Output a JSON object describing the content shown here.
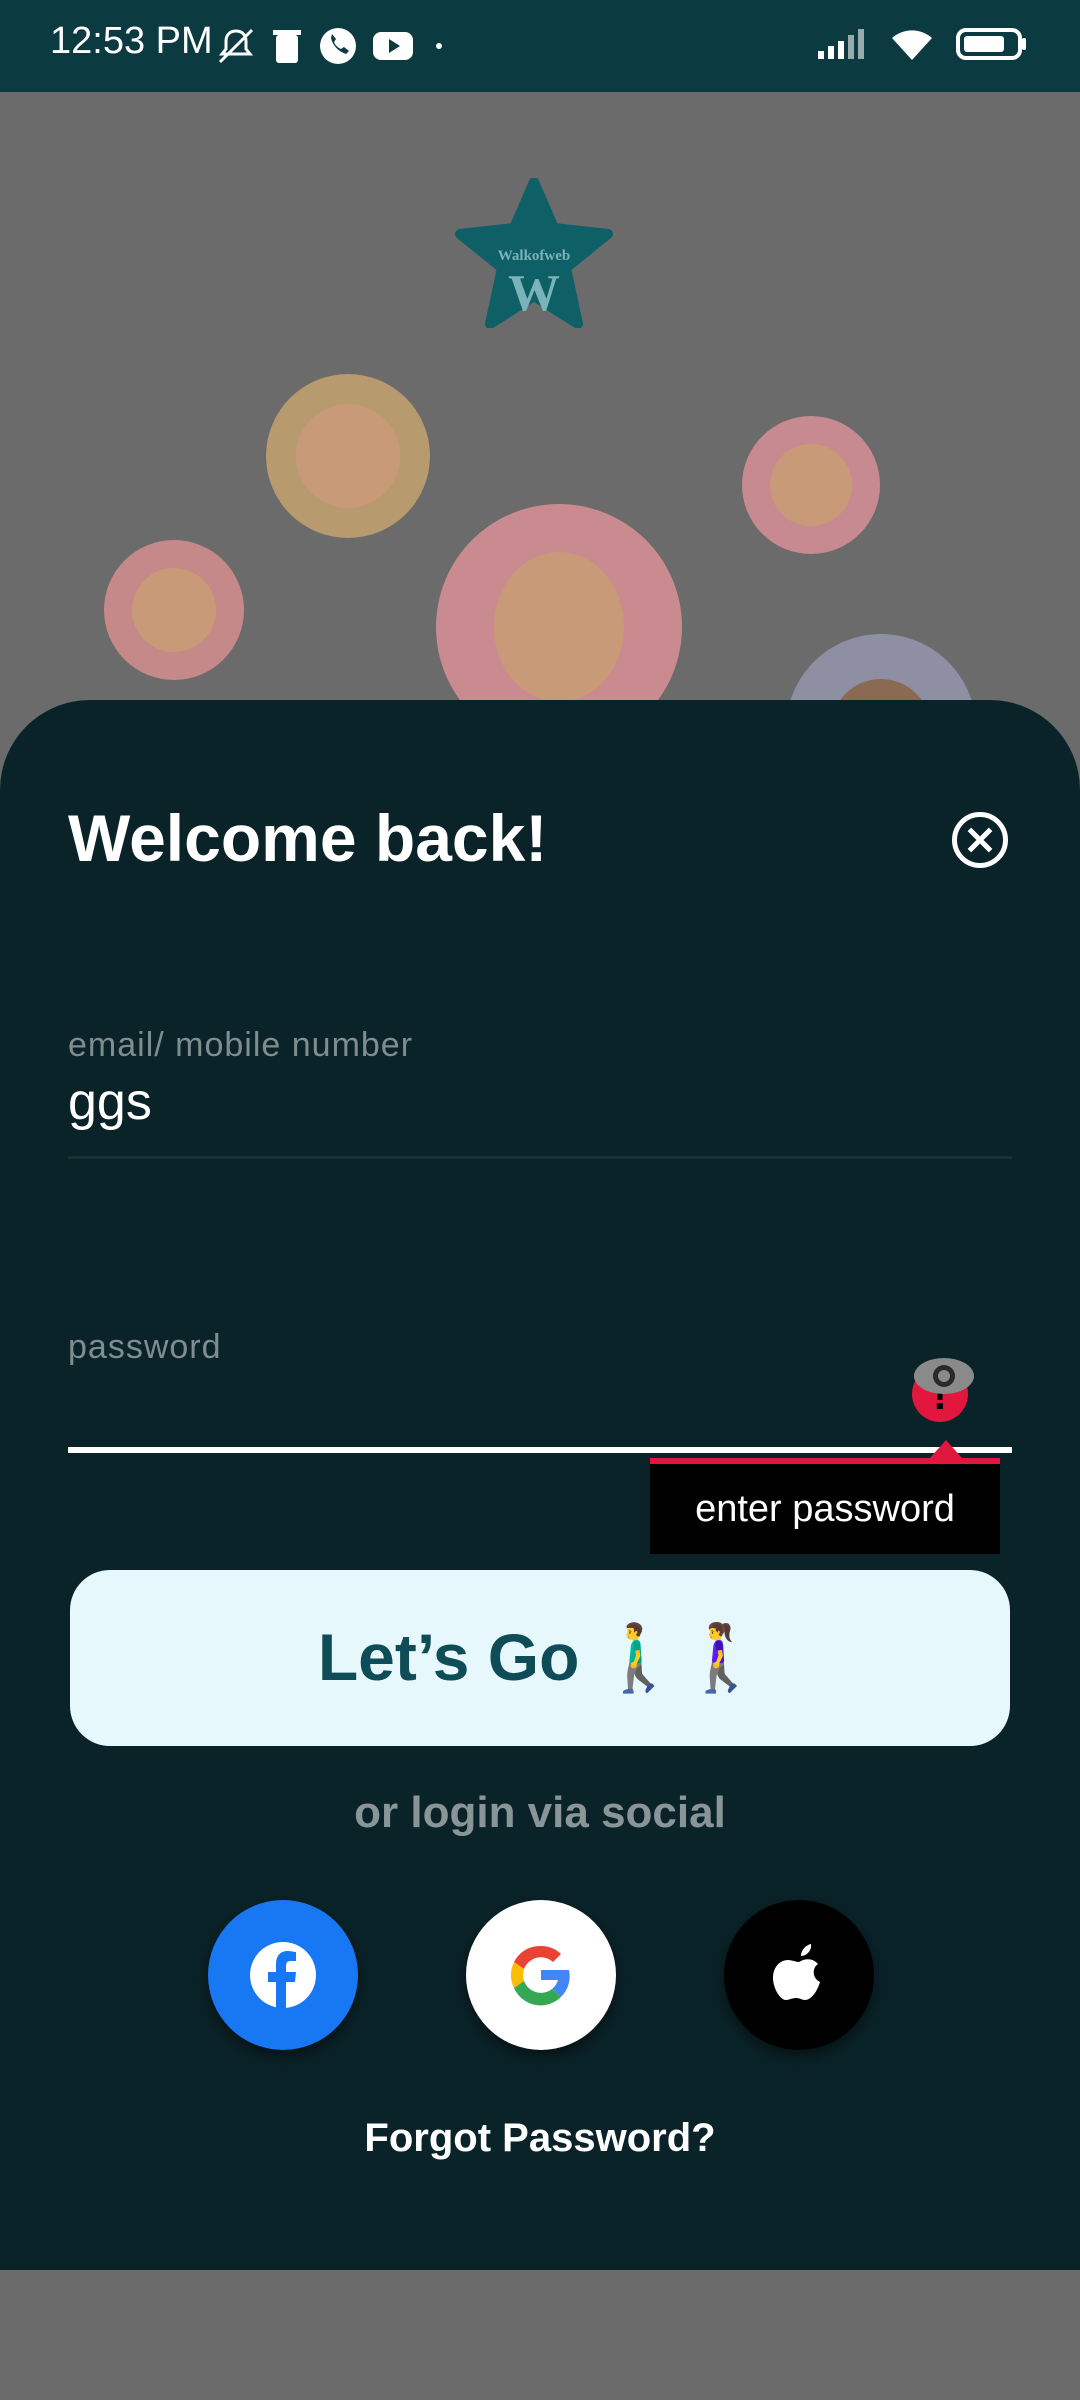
{
  "status_bar": {
    "time": "12:53 PM"
  },
  "brand": {
    "name": "Walkofweb",
    "letter": "W",
    "color": "#0e5f66"
  },
  "login": {
    "title": "Welcome back!",
    "email_label": "email/ mobile number",
    "email_value": "ggs",
    "password_label": "password",
    "password_error": "enter password",
    "submit_label": "Let’s Go 🚶‍♂️🚶‍♀️",
    "social_label": "or login via social",
    "forgot_label": "Forgot Password?"
  },
  "social": {
    "facebook": {
      "icon": "facebook-icon",
      "color": "#1877f2"
    },
    "google": {
      "icon": "google-icon",
      "color": "#ffffff"
    },
    "apple": {
      "icon": "apple-icon",
      "color": "#000000"
    }
  },
  "colors": {
    "sheet": "#0a2329",
    "accent": "#e2173d",
    "button_bg": "#e6f8fb",
    "button_text": "#0e4c58"
  }
}
